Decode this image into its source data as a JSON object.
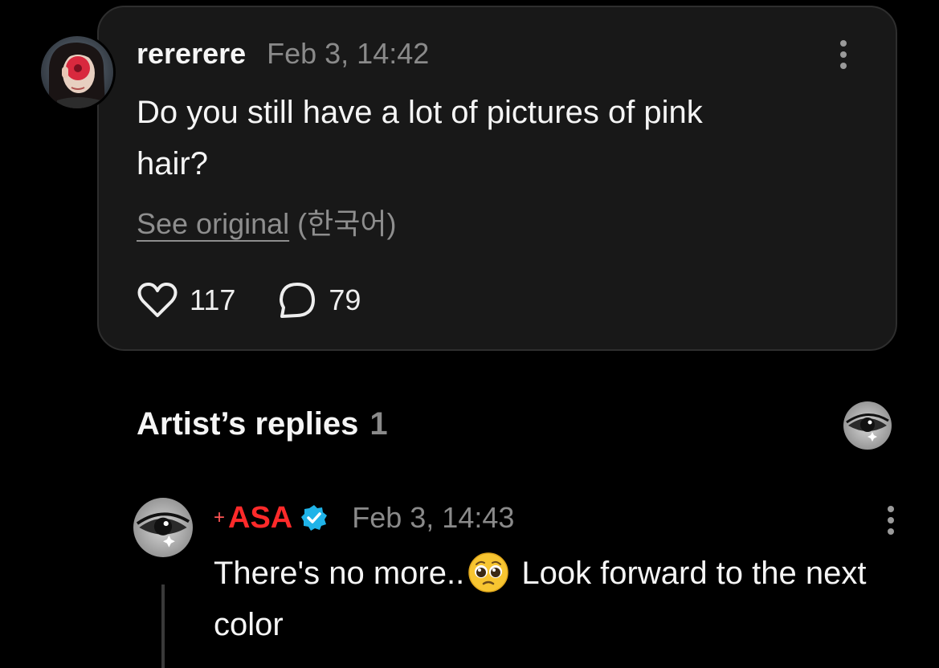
{
  "post": {
    "username": "rererere",
    "timestamp": "Feb 3, 14:42",
    "text": "Do you still have a lot of pictures of pink hair?",
    "see_original_label": "See original",
    "original_language": "(한국어)",
    "likes": "117",
    "comments": "79",
    "avatar_icon": "user-avatar-photo",
    "more_icon": "more-vertical-icon"
  },
  "replies": {
    "heading": "Artist’s replies",
    "count": "1",
    "items": [
      {
        "sparkle": "+",
        "name": "ASA",
        "verified": true,
        "timestamp": "Feb 3, 14:43",
        "text_before_emoji": "There's no more..",
        "emoji": "pleading-face-emoji",
        "text_after_emoji": " Look forward to the next color",
        "avatar_icon": "artist-avatar-eye"
      }
    ]
  },
  "colors": {
    "background": "#000000",
    "card": "#181818",
    "card_border": "#2e2e2e",
    "muted_text": "#8a8a8a",
    "artist_name": "#ff2a2a",
    "verified_badge": "#1fb3e8"
  }
}
